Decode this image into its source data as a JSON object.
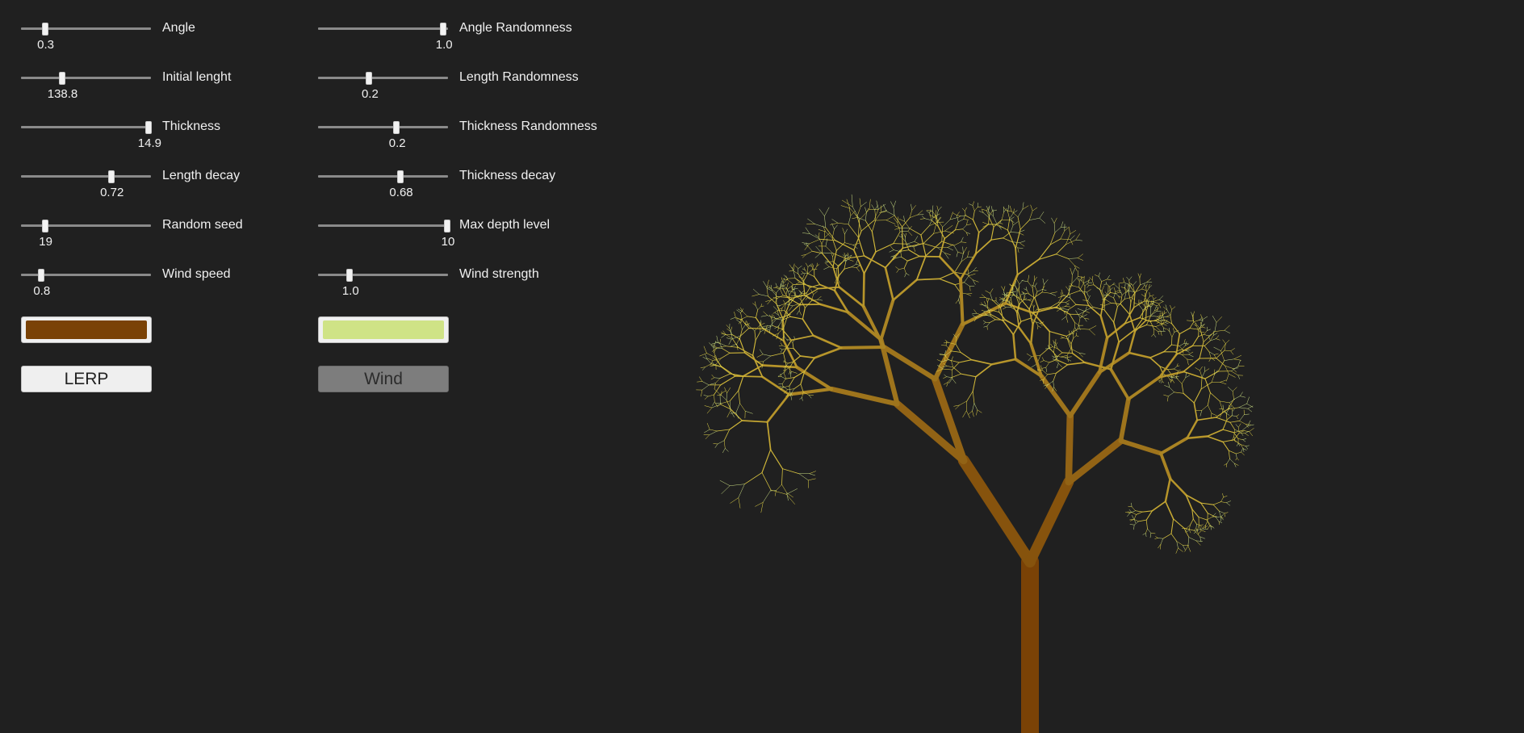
{
  "controls": {
    "left": [
      {
        "label": "Angle",
        "value": "0.3",
        "fraction": 0.19
      },
      {
        "label": "Initial lenght",
        "value": "138.8",
        "fraction": 0.32
      },
      {
        "label": "Thickness",
        "value": "14.9",
        "fraction": 0.99
      },
      {
        "label": "Length decay",
        "value": "0.72",
        "fraction": 0.7
      },
      {
        "label": "Random seed",
        "value": "19",
        "fraction": 0.19
      },
      {
        "label": "Wind speed",
        "value": "0.8",
        "fraction": 0.16
      }
    ],
    "right": [
      {
        "label": "Angle Randomness",
        "value": "1.0",
        "fraction": 0.97
      },
      {
        "label": "Length Randomness",
        "value": "0.2",
        "fraction": 0.4
      },
      {
        "label": "Thickness Randomness",
        "value": "0.2",
        "fraction": 0.61
      },
      {
        "label": "Thickness decay",
        "value": "0.68",
        "fraction": 0.64
      },
      {
        "label": "Max depth level",
        "value": "10",
        "fraction": 1.0
      },
      {
        "label": "Wind strength",
        "value": "1.0",
        "fraction": 0.25
      }
    ]
  },
  "colors": {
    "trunk_color": "#7a4206",
    "leaf_color": "#cfe386",
    "background": "#202020"
  },
  "buttons": {
    "lerp_label": "LERP",
    "wind_label": "Wind"
  }
}
